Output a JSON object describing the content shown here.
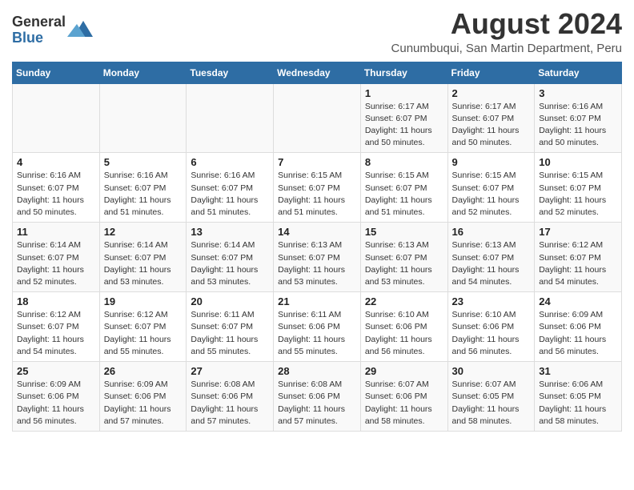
{
  "header": {
    "logo_general": "General",
    "logo_blue": "Blue",
    "title": "August 2024",
    "subtitle": "Cunumbuqui, San Martin Department, Peru"
  },
  "days_of_week": [
    "Sunday",
    "Monday",
    "Tuesday",
    "Wednesday",
    "Thursday",
    "Friday",
    "Saturday"
  ],
  "weeks": [
    [
      {
        "day": "",
        "info": ""
      },
      {
        "day": "",
        "info": ""
      },
      {
        "day": "",
        "info": ""
      },
      {
        "day": "",
        "info": ""
      },
      {
        "day": "1",
        "info": "Sunrise: 6:17 AM\nSunset: 6:07 PM\nDaylight: 11 hours and 50 minutes."
      },
      {
        "day": "2",
        "info": "Sunrise: 6:17 AM\nSunset: 6:07 PM\nDaylight: 11 hours and 50 minutes."
      },
      {
        "day": "3",
        "info": "Sunrise: 6:16 AM\nSunset: 6:07 PM\nDaylight: 11 hours and 50 minutes."
      }
    ],
    [
      {
        "day": "4",
        "info": "Sunrise: 6:16 AM\nSunset: 6:07 PM\nDaylight: 11 hours and 50 minutes."
      },
      {
        "day": "5",
        "info": "Sunrise: 6:16 AM\nSunset: 6:07 PM\nDaylight: 11 hours and 51 minutes."
      },
      {
        "day": "6",
        "info": "Sunrise: 6:16 AM\nSunset: 6:07 PM\nDaylight: 11 hours and 51 minutes."
      },
      {
        "day": "7",
        "info": "Sunrise: 6:15 AM\nSunset: 6:07 PM\nDaylight: 11 hours and 51 minutes."
      },
      {
        "day": "8",
        "info": "Sunrise: 6:15 AM\nSunset: 6:07 PM\nDaylight: 11 hours and 51 minutes."
      },
      {
        "day": "9",
        "info": "Sunrise: 6:15 AM\nSunset: 6:07 PM\nDaylight: 11 hours and 52 minutes."
      },
      {
        "day": "10",
        "info": "Sunrise: 6:15 AM\nSunset: 6:07 PM\nDaylight: 11 hours and 52 minutes."
      }
    ],
    [
      {
        "day": "11",
        "info": "Sunrise: 6:14 AM\nSunset: 6:07 PM\nDaylight: 11 hours and 52 minutes."
      },
      {
        "day": "12",
        "info": "Sunrise: 6:14 AM\nSunset: 6:07 PM\nDaylight: 11 hours and 53 minutes."
      },
      {
        "day": "13",
        "info": "Sunrise: 6:14 AM\nSunset: 6:07 PM\nDaylight: 11 hours and 53 minutes."
      },
      {
        "day": "14",
        "info": "Sunrise: 6:13 AM\nSunset: 6:07 PM\nDaylight: 11 hours and 53 minutes."
      },
      {
        "day": "15",
        "info": "Sunrise: 6:13 AM\nSunset: 6:07 PM\nDaylight: 11 hours and 53 minutes."
      },
      {
        "day": "16",
        "info": "Sunrise: 6:13 AM\nSunset: 6:07 PM\nDaylight: 11 hours and 54 minutes."
      },
      {
        "day": "17",
        "info": "Sunrise: 6:12 AM\nSunset: 6:07 PM\nDaylight: 11 hours and 54 minutes."
      }
    ],
    [
      {
        "day": "18",
        "info": "Sunrise: 6:12 AM\nSunset: 6:07 PM\nDaylight: 11 hours and 54 minutes."
      },
      {
        "day": "19",
        "info": "Sunrise: 6:12 AM\nSunset: 6:07 PM\nDaylight: 11 hours and 55 minutes."
      },
      {
        "day": "20",
        "info": "Sunrise: 6:11 AM\nSunset: 6:07 PM\nDaylight: 11 hours and 55 minutes."
      },
      {
        "day": "21",
        "info": "Sunrise: 6:11 AM\nSunset: 6:06 PM\nDaylight: 11 hours and 55 minutes."
      },
      {
        "day": "22",
        "info": "Sunrise: 6:10 AM\nSunset: 6:06 PM\nDaylight: 11 hours and 56 minutes."
      },
      {
        "day": "23",
        "info": "Sunrise: 6:10 AM\nSunset: 6:06 PM\nDaylight: 11 hours and 56 minutes."
      },
      {
        "day": "24",
        "info": "Sunrise: 6:09 AM\nSunset: 6:06 PM\nDaylight: 11 hours and 56 minutes."
      }
    ],
    [
      {
        "day": "25",
        "info": "Sunrise: 6:09 AM\nSunset: 6:06 PM\nDaylight: 11 hours and 56 minutes."
      },
      {
        "day": "26",
        "info": "Sunrise: 6:09 AM\nSunset: 6:06 PM\nDaylight: 11 hours and 57 minutes."
      },
      {
        "day": "27",
        "info": "Sunrise: 6:08 AM\nSunset: 6:06 PM\nDaylight: 11 hours and 57 minutes."
      },
      {
        "day": "28",
        "info": "Sunrise: 6:08 AM\nSunset: 6:06 PM\nDaylight: 11 hours and 57 minutes."
      },
      {
        "day": "29",
        "info": "Sunrise: 6:07 AM\nSunset: 6:06 PM\nDaylight: 11 hours and 58 minutes."
      },
      {
        "day": "30",
        "info": "Sunrise: 6:07 AM\nSunset: 6:05 PM\nDaylight: 11 hours and 58 minutes."
      },
      {
        "day": "31",
        "info": "Sunrise: 6:06 AM\nSunset: 6:05 PM\nDaylight: 11 hours and 58 minutes."
      }
    ]
  ]
}
